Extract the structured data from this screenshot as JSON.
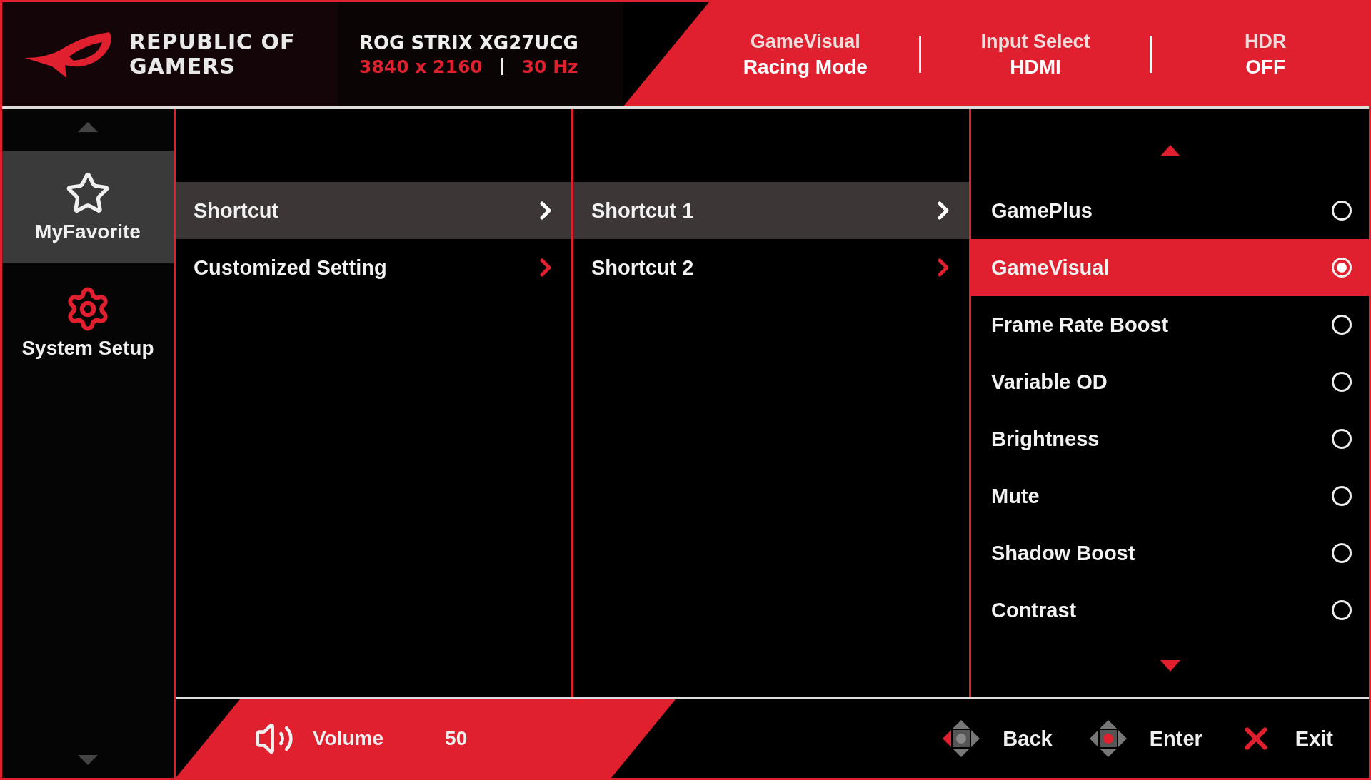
{
  "brand": {
    "lines": [
      "REPUBLIC OF",
      "GAMERS"
    ]
  },
  "model": {
    "name": "ROG STRIX XG27UCG",
    "resolution": "3840 x 2160",
    "refresh": "30 Hz"
  },
  "status": [
    {
      "label": "GameVisual",
      "value": "Racing Mode"
    },
    {
      "label": "Input Select",
      "value": "HDMI"
    },
    {
      "label": "HDR",
      "value": "OFF"
    }
  ],
  "sidebar": {
    "items": [
      {
        "kind": "star",
        "label": "MyFavorite",
        "selected": true
      },
      {
        "kind": "gear",
        "label": "System Setup",
        "selected": false
      }
    ]
  },
  "menu": [
    {
      "label": "Shortcut",
      "selected": true
    },
    {
      "label": "Customized Setting",
      "selected": false
    }
  ],
  "submenu": [
    {
      "label": "Shortcut 1",
      "selected": true
    },
    {
      "label": "Shortcut 2",
      "selected": false
    }
  ],
  "options": [
    {
      "label": "GamePlus",
      "selected": false
    },
    {
      "label": "GameVisual",
      "selected": true
    },
    {
      "label": "Frame Rate Boost",
      "selected": false
    },
    {
      "label": "Variable OD",
      "selected": false
    },
    {
      "label": "Brightness",
      "selected": false
    },
    {
      "label": "Mute",
      "selected": false
    },
    {
      "label": "Shadow Boost",
      "selected": false
    },
    {
      "label": "Contrast",
      "selected": false
    }
  ],
  "volume": {
    "label": "Volume",
    "value": "50"
  },
  "controls": [
    {
      "kind": "back",
      "label": "Back"
    },
    {
      "kind": "enter",
      "label": "Enter"
    },
    {
      "kind": "exit",
      "label": "Exit"
    }
  ]
}
